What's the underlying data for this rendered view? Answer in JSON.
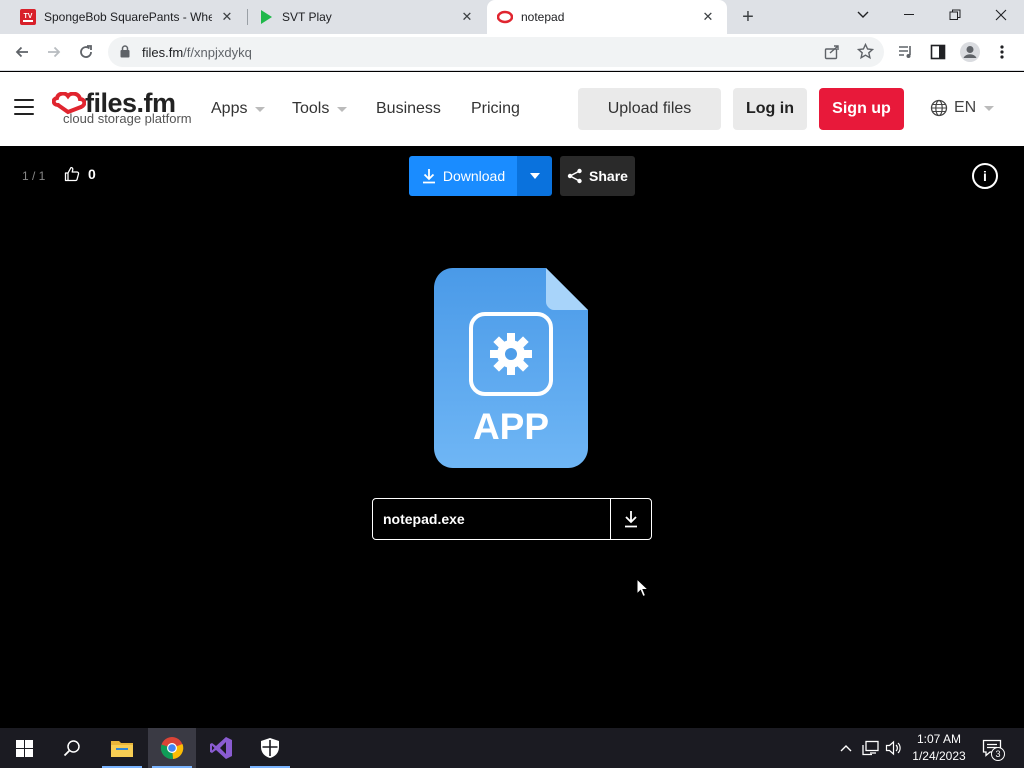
{
  "browser": {
    "tabs": [
      {
        "title": "SpongeBob SquarePants - Where",
        "favicon": "tv-guide-icon",
        "active": false
      },
      {
        "title": "SVT Play",
        "favicon": "play-icon",
        "active": false
      },
      {
        "title": "notepad",
        "favicon": "files-fm-icon",
        "active": true
      }
    ],
    "address": {
      "host": "files.fm",
      "path": "/f/xnpjxdykq"
    }
  },
  "site": {
    "logo": {
      "brand": "files.fm",
      "tagline": "cloud storage platform"
    },
    "nav": [
      {
        "label": "Apps",
        "has_dropdown": true
      },
      {
        "label": "Tools",
        "has_dropdown": true
      },
      {
        "label": "Business",
        "has_dropdown": false
      },
      {
        "label": "Pricing",
        "has_dropdown": false
      }
    ],
    "upload_label": "Upload files",
    "login_label": "Log in",
    "signup_label": "Sign up",
    "language": "EN",
    "colors": {
      "accent": "#1a8cff",
      "signup": "#e8193a"
    }
  },
  "viewer": {
    "counter": "1 / 1",
    "likes": "0",
    "download_label": "Download",
    "share_label": "Share",
    "file_type_label": "APP",
    "file_name": "notepad.exe"
  },
  "taskbar": {
    "time": "1:07 AM",
    "date": "1/24/2023",
    "notifications": "3"
  }
}
